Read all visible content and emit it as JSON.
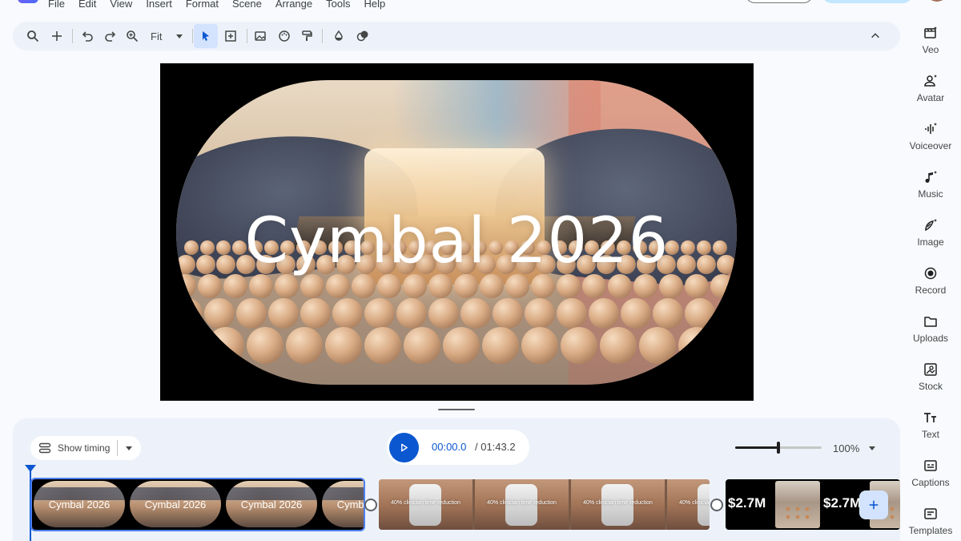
{
  "menu": [
    "File",
    "Edit",
    "View",
    "Insert",
    "Format",
    "Scene",
    "Arrange",
    "Tools",
    "Help"
  ],
  "toolbar": {
    "zoom_value": "Fit"
  },
  "canvas": {
    "title": "Cymbal 2026"
  },
  "timeline": {
    "show_timing_label": "Show timing",
    "current_time": "00:00.0",
    "total_time": "/ 01:43.2",
    "zoom_percent": "100%",
    "zoom_level": 0.5,
    "clips": [
      {
        "thumb_label": "Cymbal 2026"
      },
      {
        "thumb_label": "40% clinician time reduction"
      },
      {
        "thumb_label": "$2.7M"
      }
    ]
  },
  "rail": [
    {
      "label": "Veo",
      "icon": "veo-icon"
    },
    {
      "label": "Avatar",
      "icon": "avatar-icon"
    },
    {
      "label": "Voiceover",
      "icon": "voiceover-icon"
    },
    {
      "label": "Music",
      "icon": "music-icon"
    },
    {
      "label": "Image",
      "icon": "image-icon"
    },
    {
      "label": "Record",
      "icon": "record-icon"
    },
    {
      "label": "Uploads",
      "icon": "uploads-icon"
    },
    {
      "label": "Stock",
      "icon": "stock-icon"
    },
    {
      "label": "Text",
      "icon": "text-icon"
    },
    {
      "label": "Captions",
      "icon": "captions-icon"
    },
    {
      "label": "Templates",
      "icon": "templates-icon"
    }
  ],
  "colors": {
    "accent": "#0b57d0",
    "toolbar_bg": "#edf2fa",
    "page_bg": "#f8fafd"
  }
}
